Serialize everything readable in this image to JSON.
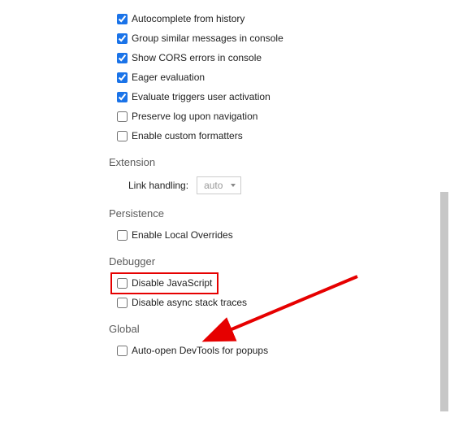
{
  "console_options": [
    {
      "checked": true,
      "label": "Autocomplete from history"
    },
    {
      "checked": true,
      "label": "Group similar messages in console"
    },
    {
      "checked": true,
      "label": "Show CORS errors in console"
    },
    {
      "checked": true,
      "label": "Eager evaluation"
    },
    {
      "checked": true,
      "label": "Evaluate triggers user activation"
    },
    {
      "checked": false,
      "label": "Preserve log upon navigation"
    },
    {
      "checked": false,
      "label": "Enable custom formatters"
    }
  ],
  "sections": {
    "extension": {
      "title": "Extension",
      "link_handling_label": "Link handling:",
      "link_handling_value": "auto"
    },
    "persistence": {
      "title": "Persistence",
      "options": [
        {
          "checked": false,
          "label": "Enable Local Overrides"
        }
      ]
    },
    "debugger": {
      "title": "Debugger",
      "options": [
        {
          "checked": false,
          "label": "Disable JavaScript",
          "highlighted": true
        },
        {
          "checked": false,
          "label": "Disable async stack traces"
        }
      ]
    },
    "global": {
      "title": "Global",
      "options": [
        {
          "checked": false,
          "label": "Auto-open DevTools for popups"
        }
      ]
    }
  },
  "annotation": {
    "color": "#e60000"
  }
}
